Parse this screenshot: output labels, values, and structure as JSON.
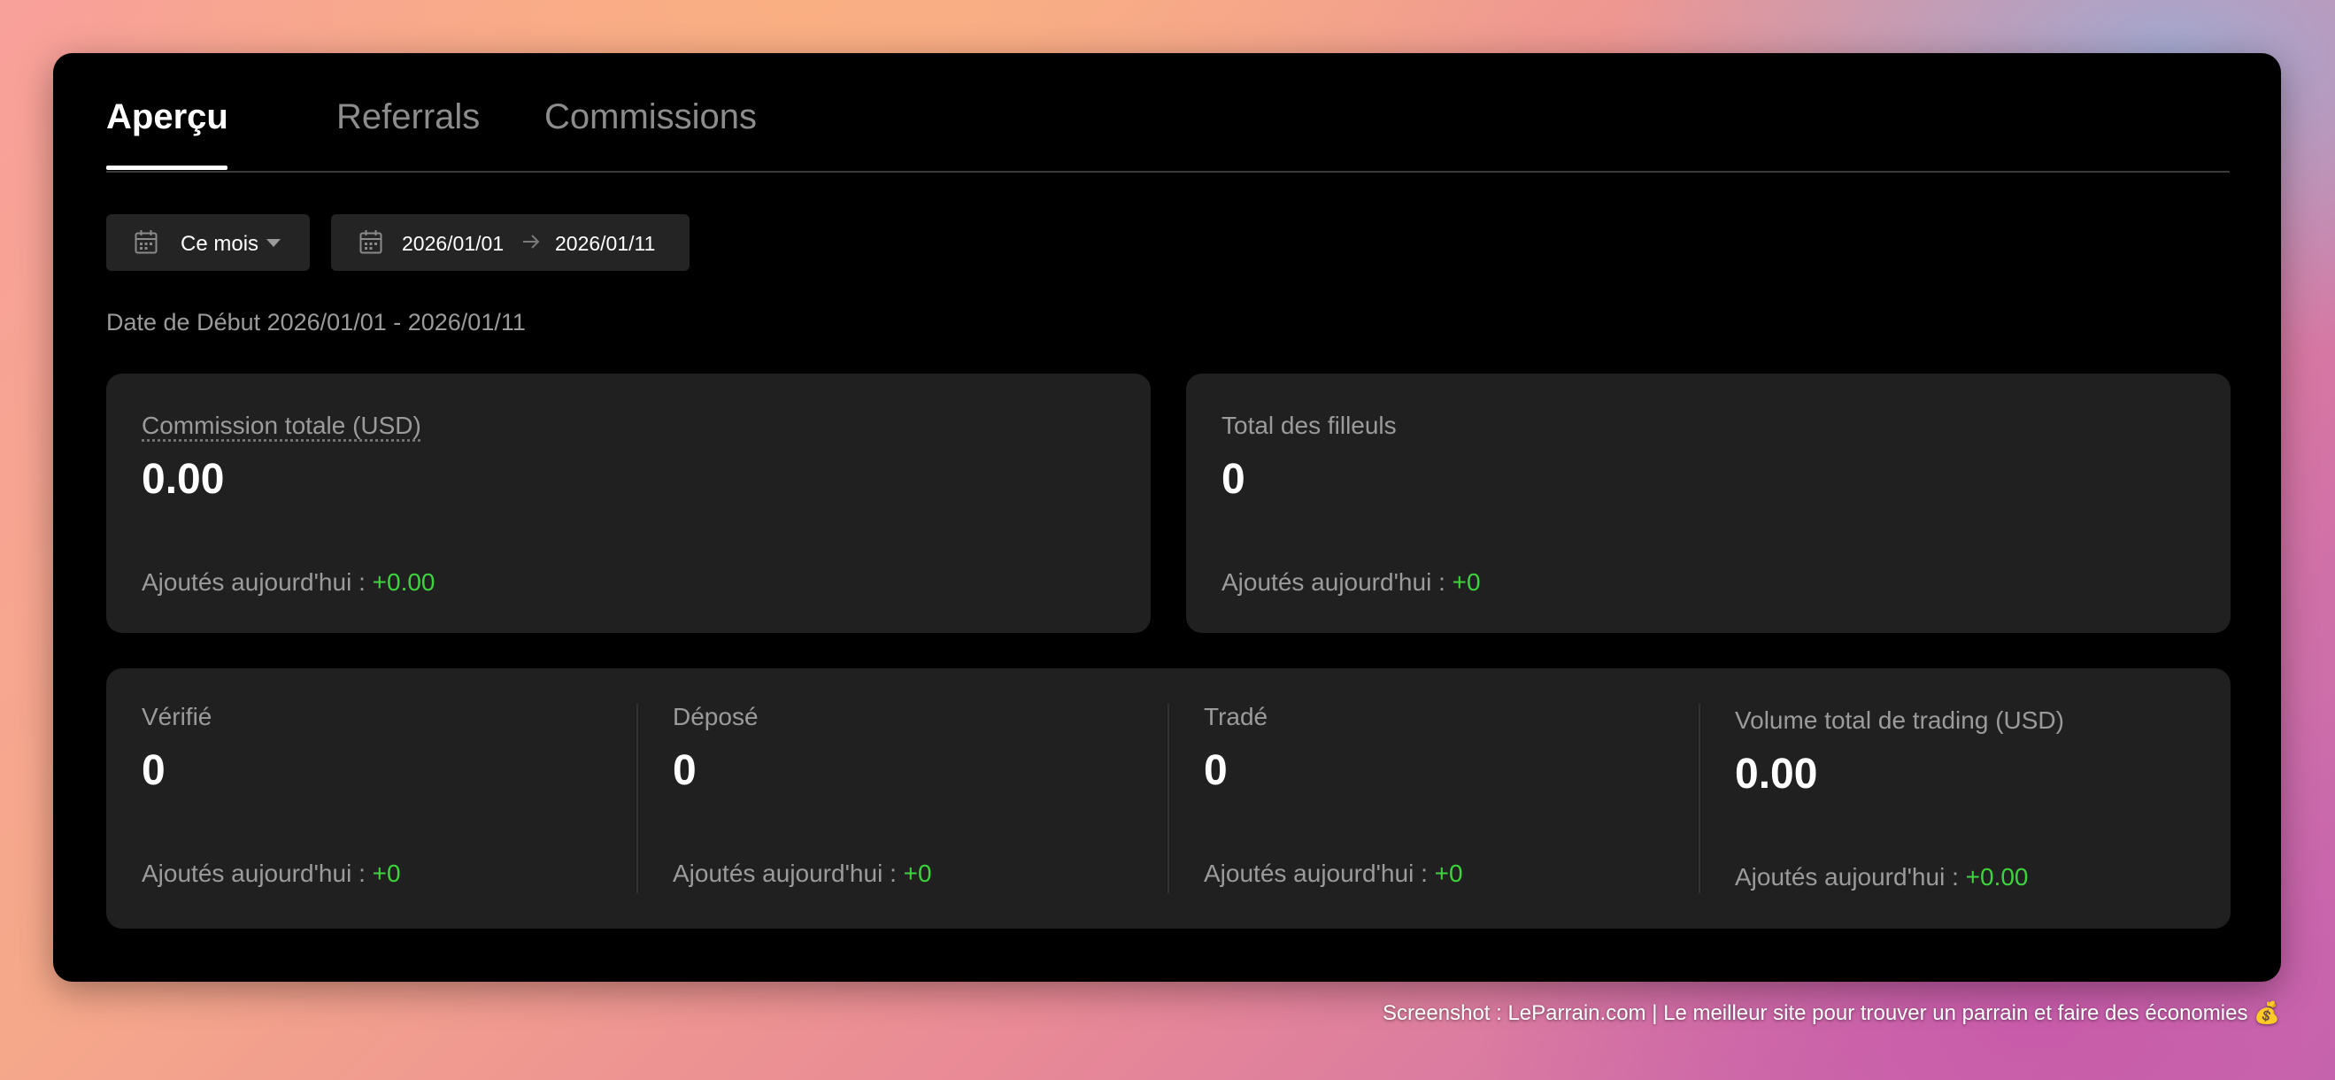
{
  "tabs": [
    {
      "label": "Aperçu",
      "active": true
    },
    {
      "label": "Referrals",
      "active": false
    },
    {
      "label": "Commissions",
      "active": false
    }
  ],
  "filters": {
    "period_label": "Ce mois",
    "range_start": "2026/01/01",
    "range_end": "2026/01/11"
  },
  "date_caption": "Date de Début 2026/01/01 - 2026/01/11",
  "summary_cards": [
    {
      "label": "Commission totale (USD)",
      "value": "0.00",
      "sub_label": "Ajoutés aujourd'hui : ",
      "sub_value": "+0.00"
    },
    {
      "label": "Total des filleuls",
      "value": "0",
      "sub_label": "Ajoutés aujourd'hui : ",
      "sub_value": "+0"
    }
  ],
  "stats": [
    {
      "label": "Vérifié",
      "value": "0",
      "sub_label": "Ajoutés aujourd'hui : ",
      "sub_value": "+0"
    },
    {
      "label": "Déposé",
      "value": "0",
      "sub_label": "Ajoutés aujourd'hui : ",
      "sub_value": "+0"
    },
    {
      "label": "Tradé",
      "value": "0",
      "sub_label": "Ajoutés aujourd'hui : ",
      "sub_value": "+0"
    },
    {
      "label": "Volume total de trading (USD)",
      "value": "0.00",
      "sub_label": "Ajoutés aujourd'hui : ",
      "sub_value": "+0.00"
    }
  ],
  "watermark": "Screenshot : LeParrain.com | Le meilleur site pour trouver un parrain et faire des économies 💰",
  "colors": {
    "positive": "#3ed33e",
    "panel": "#000000",
    "card": "#202020"
  },
  "icons": [
    "calendar-icon",
    "caret-down-icon",
    "arrow-right-icon"
  ]
}
